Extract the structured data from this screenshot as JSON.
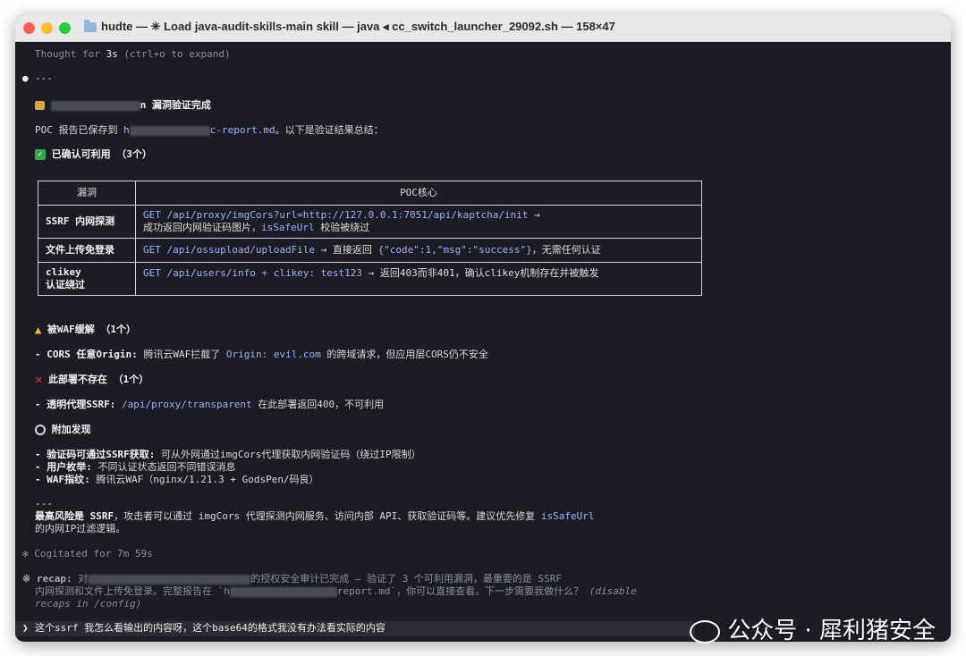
{
  "window": {
    "title": "hudte — ✳ Load java-audit-skills-main skill — java ◂ cc_switch_launcher_29092.sh — 158×47"
  },
  "terminal": {
    "thought": "Thought for",
    "thought_time": "3s",
    "thought_hint": "(ctrl+o to expand)",
    "bullet": "●",
    "hr": "---",
    "heading_suffix": "n 漏洞验证完成",
    "poc_saved_prefix": "POC 报告已保存到",
    "poc_path_start": "h",
    "poc_path_end": "c-report.md",
    "poc_saved_suffix": "。以下是验证结果总结：",
    "confirmed_heading": "已确认可利用 （3个）",
    "table": {
      "headers": [
        "漏洞",
        "POC核心"
      ],
      "rows": [
        {
          "name": "SSRF 内网探测",
          "code1": "GET /api/proxy/imgCors?url=http://127.0.0.1:7051/api/kaptcha/init",
          "arrow": " →",
          "line2a": "成功返回内网验证码图片，",
          "code2": "isSafeUrl",
          "line2b": " 校验被绕过"
        },
        {
          "name": "文件上传免登录",
          "code1": "GET /api/ossupload/uploadFile",
          "text1": " → 直接返回 ",
          "code2": "{\"code\":1,\"msg\":\"success\"}",
          "text2": "，无需任何认证"
        },
        {
          "name_line1": "clikey",
          "name_line2": "认证绕过",
          "code1": "GET /api/users/info + clikey: test123",
          "text1": " → 返回403而非401，确认clikey机制存在并被触发"
        }
      ]
    },
    "waf_heading": "被WAF缓解 （1个）",
    "waf_item_label": "- CORS 任意Origin:",
    "waf_item_text1": " 腾讯云WAF拦截了 ",
    "waf_item_code": "Origin: evil.com",
    "waf_item_text2": " 的跨域请求，但应用层CORS仍不安全",
    "absent_heading": "此部署不存在 （1个）",
    "absent_item_label": "- 透明代理SSRF:",
    "absent_item_code": " /api/proxy/transparent",
    "absent_item_text": " 在此部署返回400，不可利用",
    "extra_heading": "附加发现",
    "extra_items": [
      {
        "label": "- 验证码可通过SSRF获取:",
        "text": " 可从外网通过imgCors代理获取内网验证码（绕过IP限制）"
      },
      {
        "label": "- 用户枚举:",
        "text": " 不同认证状态返回不同错误消息"
      },
      {
        "label": "- WAF指纹:",
        "text": " 腾讯云WAF（nginx/1.21.3 + GodsPen/码良）"
      }
    ],
    "hr2": "---",
    "summary_bold": "最高风险是 SSRF",
    "summary_text": "，攻击者可以通过 imgCors 代理探测内网服务、访问内部 API、获取验证码等。建议优先修复 ",
    "summary_code": "isSafeUrl",
    "summary_line2": "的内网IP过滤逻辑。",
    "cogitated": "✻ Cogitated for 7m 59s",
    "recap_label": "※ recap:",
    "recap_a": " 对",
    "recap_b": "的授权安全审计已完成 — 验证了 3 个可利用漏洞，最重要的是 SSRF",
    "recap_line2a": "内网探测和文件上传免登录。完整报告在 `h",
    "recap_line2b": "report.md`，你可以直接查看。下一步需要我做什么？",
    "recap_disable": "(disable",
    "recap_line3": "recaps in /config)",
    "prompt_symbol": "❯",
    "prompt_text": "这个ssrf 我怎么看输出的内容呀，这个base64的格式我没有办法看实际的内容"
  },
  "watermark": {
    "text": "公众号 · 犀利猪安全"
  }
}
